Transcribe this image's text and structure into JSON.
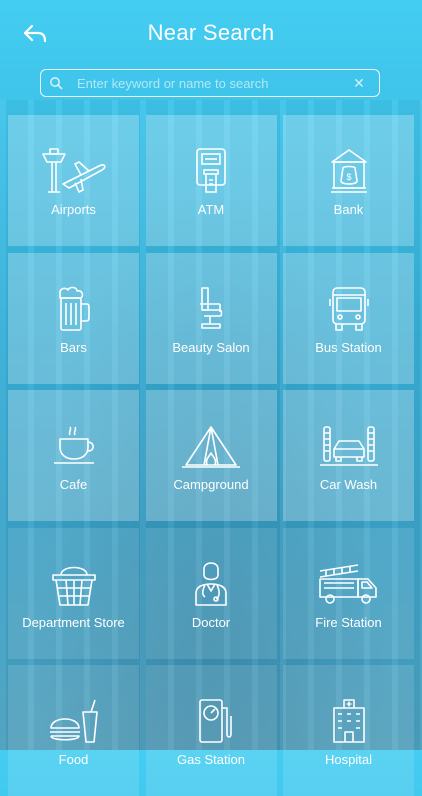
{
  "header": {
    "title": "Near Search"
  },
  "search": {
    "placeholder": "Enter keyword or name to search",
    "clear_symbol": "✕"
  },
  "categories": [
    {
      "label": "Airports",
      "icon": "airport-icon"
    },
    {
      "label": "ATM",
      "icon": "atm-icon"
    },
    {
      "label": "Bank",
      "icon": "bank-icon"
    },
    {
      "label": "Bars",
      "icon": "beer-mug-icon"
    },
    {
      "label": "Beauty Salon",
      "icon": "salon-chair-icon"
    },
    {
      "label": "Bus Station",
      "icon": "bus-icon"
    },
    {
      "label": "Cafe",
      "icon": "coffee-cup-icon"
    },
    {
      "label": "Campground",
      "icon": "tent-icon"
    },
    {
      "label": "Car Wash",
      "icon": "car-wash-icon"
    },
    {
      "label": "Department Store",
      "icon": "shopping-basket-icon"
    },
    {
      "label": "Doctor",
      "icon": "doctor-icon"
    },
    {
      "label": "Fire Station",
      "icon": "fire-truck-icon"
    },
    {
      "label": "Food",
      "icon": "fast-food-icon"
    },
    {
      "label": "Gas Station",
      "icon": "gas-pump-icon"
    },
    {
      "label": "Hospital",
      "icon": "hospital-icon"
    }
  ],
  "colors": {
    "accent": "#44cdf2",
    "tile": "#ffffff"
  }
}
